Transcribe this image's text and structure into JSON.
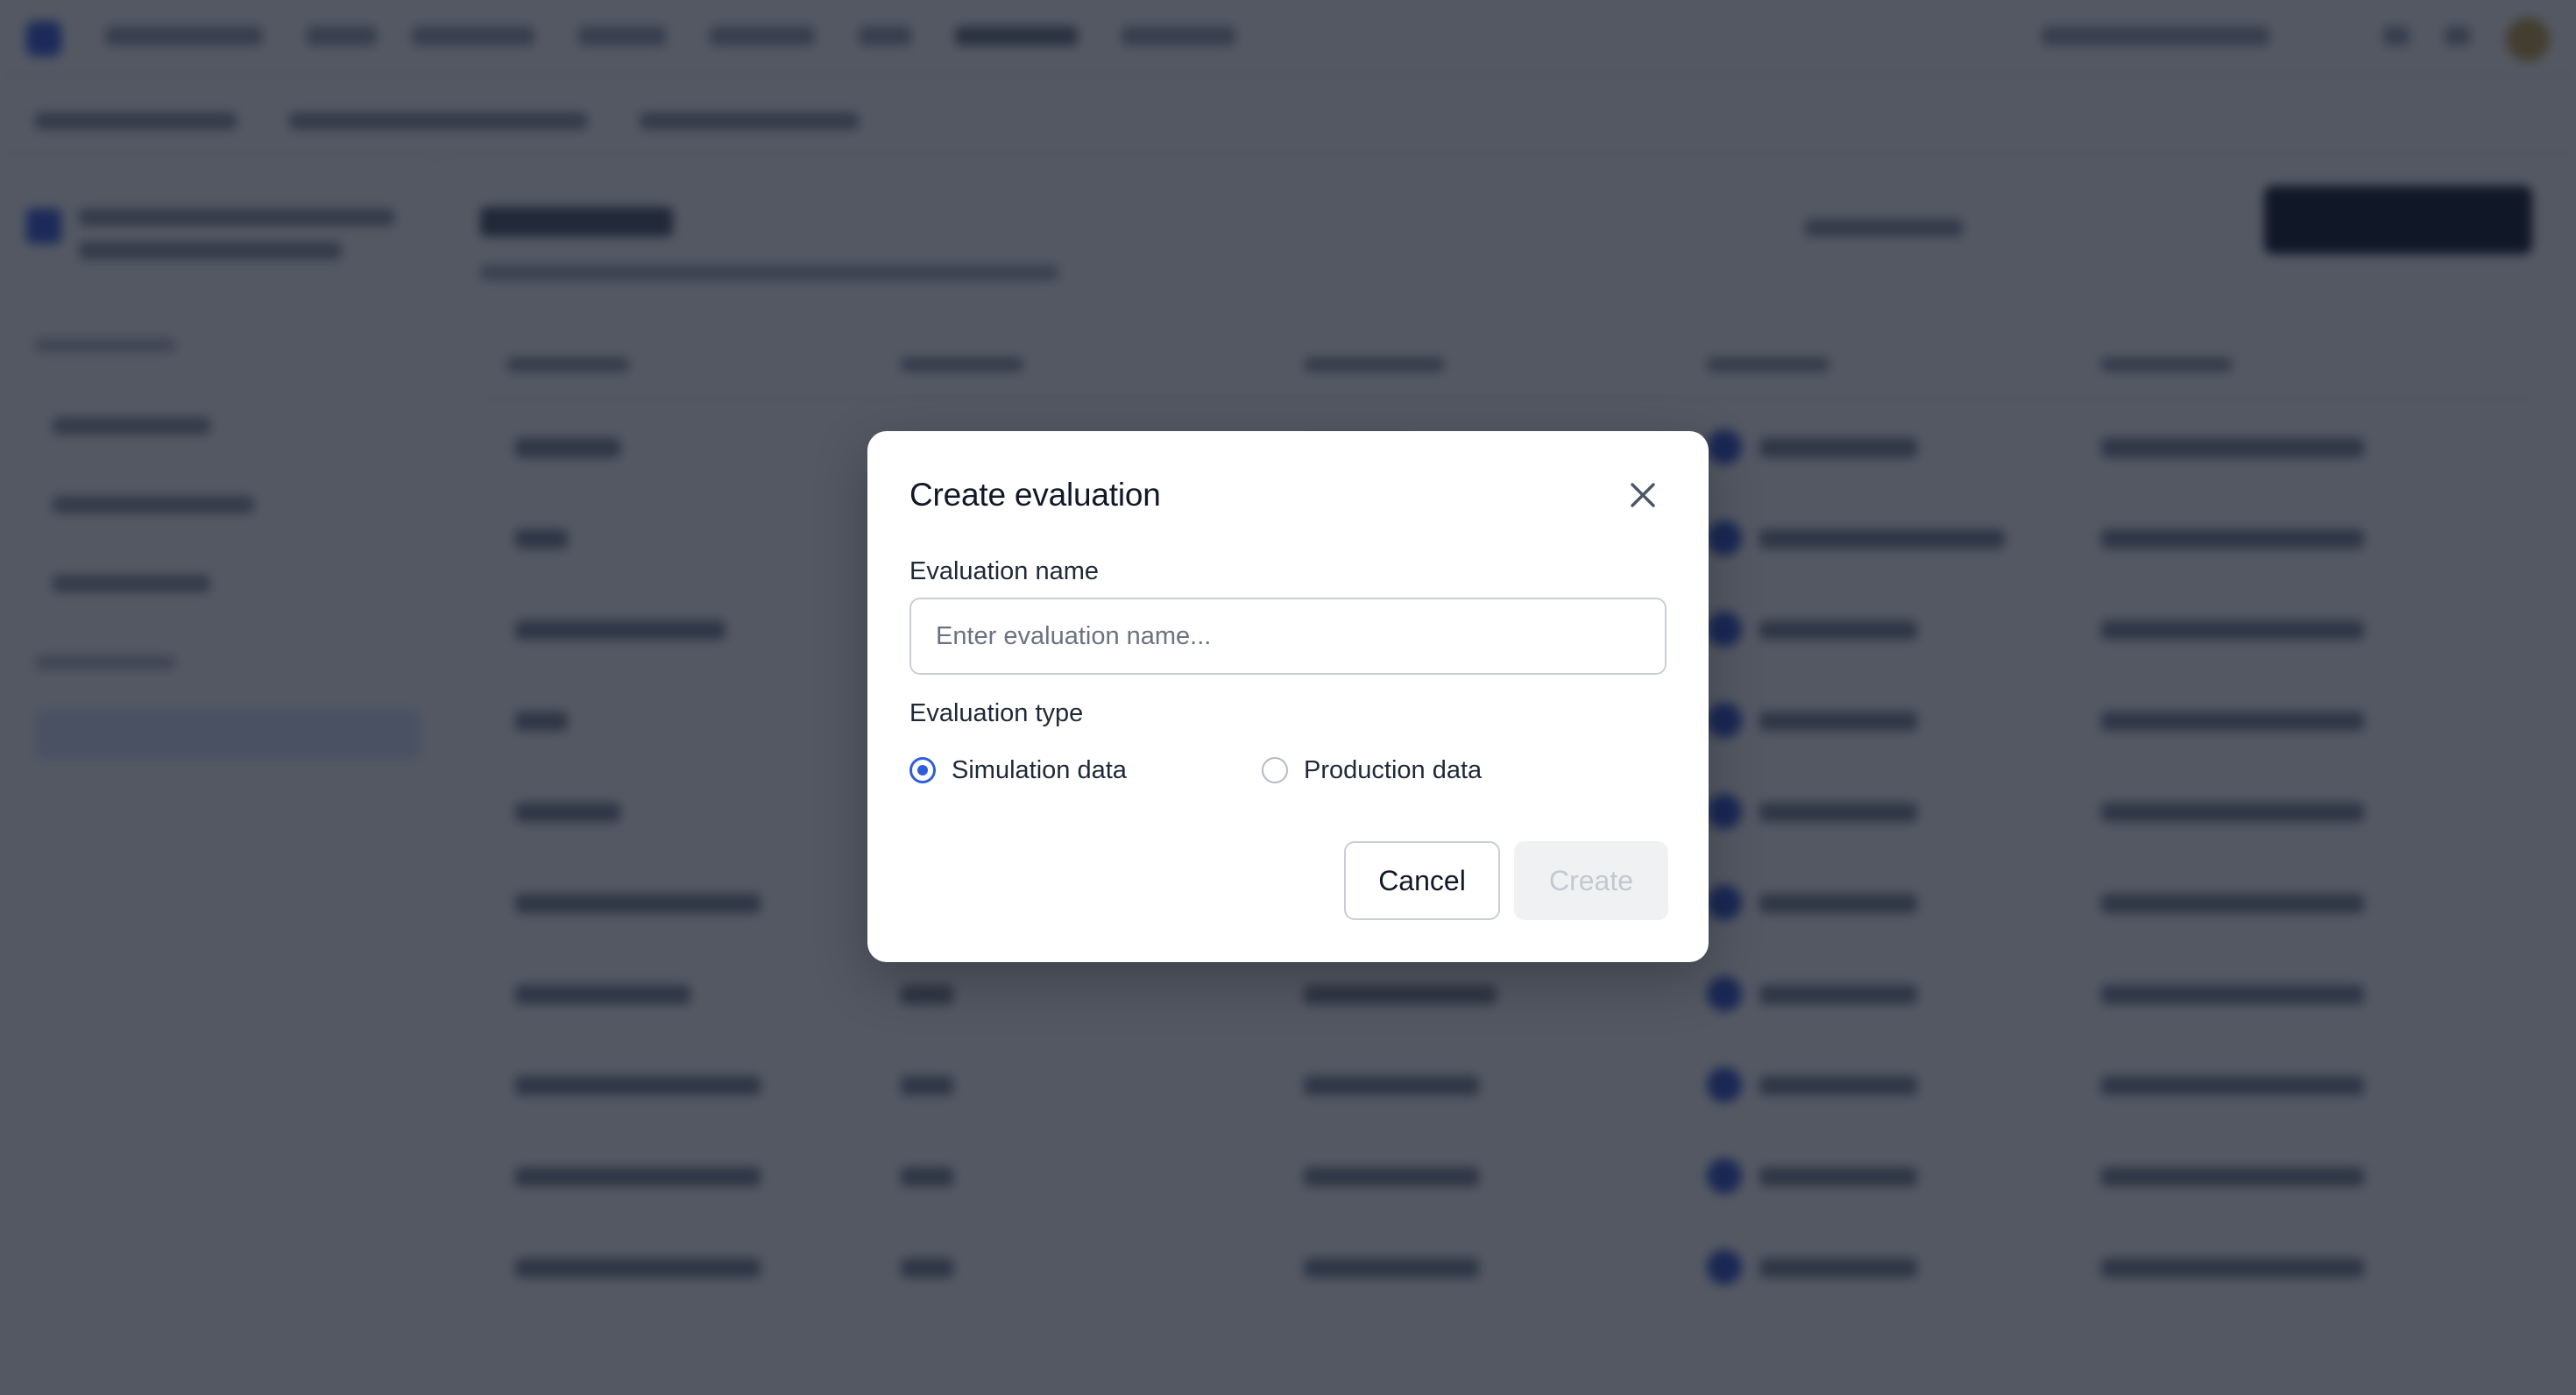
{
  "dialog": {
    "title": "Create evaluation",
    "close_icon": "close-icon",
    "name_label": "Evaluation name",
    "name_placeholder": "Enter evaluation name...",
    "name_value": "",
    "type_label": "Evaluation type",
    "type_options": [
      {
        "label": "Simulation data",
        "selected": true
      },
      {
        "label": "Production data",
        "selected": false
      }
    ],
    "cancel_label": "Cancel",
    "create_label": "Create",
    "create_disabled": true
  },
  "colors": {
    "accent": "#2f5fd8",
    "overlay": "#4b5260",
    "text_primary": "#111827",
    "disabled_text": "#c4c8cf"
  }
}
